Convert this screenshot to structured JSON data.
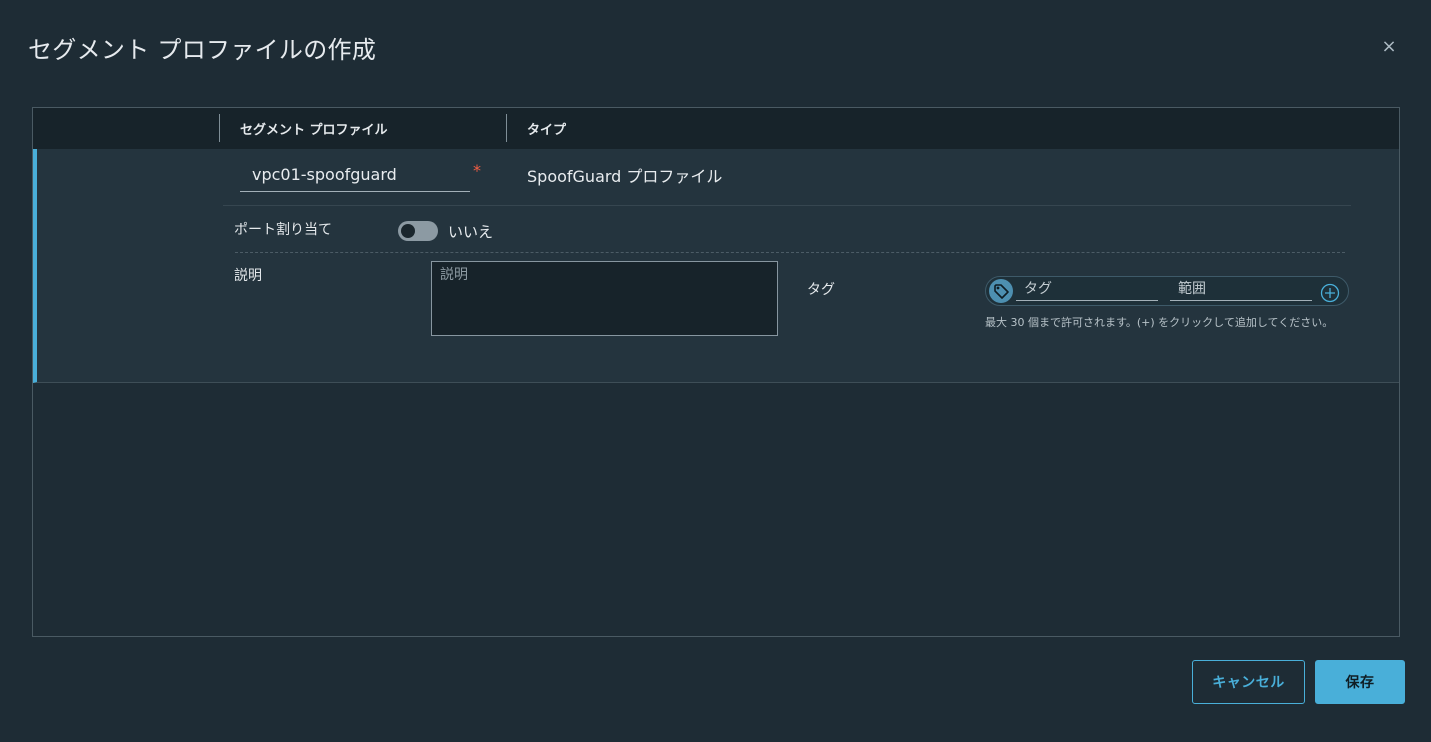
{
  "dialog": {
    "title": "セグメント プロファイルの作成",
    "close_label": "×"
  },
  "grid": {
    "columns": [
      {
        "label": "セグメント プロファイル"
      },
      {
        "label": "タイプ"
      }
    ],
    "row": {
      "name_value": "vpc01-spoofguard",
      "required_marker": "*",
      "type_value": "SpoofGuard プロファイル"
    }
  },
  "form": {
    "port_binding": {
      "label": "ポート割り当て",
      "toggle_state": "いいえ",
      "enabled": false
    },
    "description": {
      "label": "説明",
      "placeholder": "説明",
      "value": ""
    },
    "tags": {
      "label": "タグ",
      "tag_placeholder": "タグ",
      "scope_placeholder": "範囲",
      "help": "最大 30 個まで許可されます。(+) をクリックして追加してください。"
    }
  },
  "footer": {
    "cancel_label": "キャンセル",
    "save_label": "保存"
  },
  "colors": {
    "accent": "#49afd9",
    "background": "#1e2c35",
    "required": "#f35e44"
  }
}
